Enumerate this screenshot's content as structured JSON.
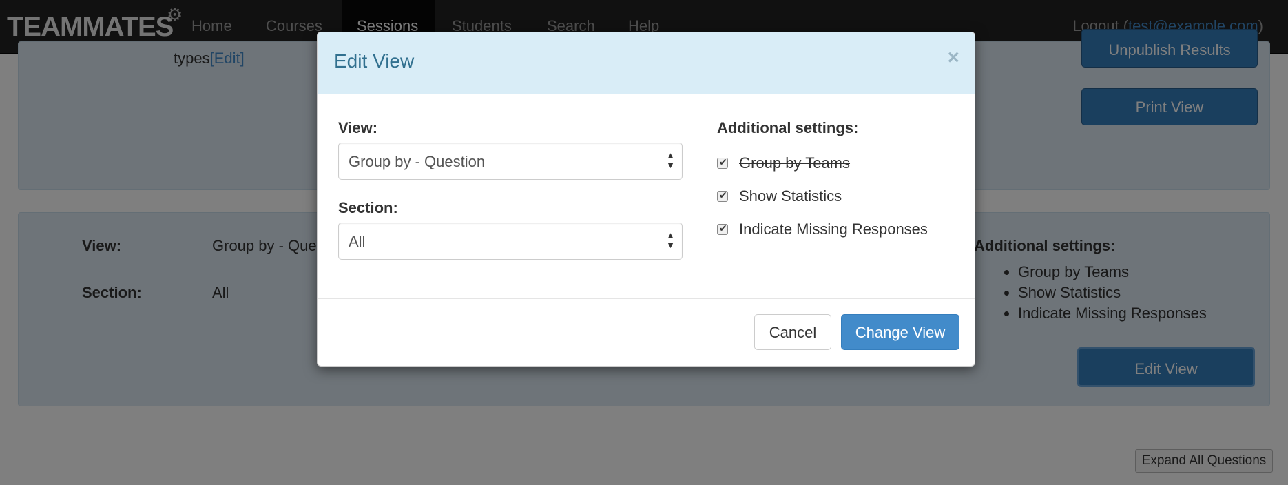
{
  "navbar": {
    "brand": "TEAMMATES",
    "items": [
      {
        "label": "Home"
      },
      {
        "label": "Courses"
      },
      {
        "label": "Sessions"
      },
      {
        "label": "Students"
      },
      {
        "label": "Search"
      },
      {
        "label": "Help"
      }
    ],
    "active_item": "Sessions",
    "logout_prefix": "Logout (",
    "logout_email": "test@example.com",
    "logout_suffix": ")"
  },
  "top_panel": {
    "types_text": "types",
    "edit_link": "[Edit]",
    "unpublish_label": "Unpublish Results",
    "print_label": "Print View"
  },
  "view_panel": {
    "view_label": "View:",
    "view_value": "Group by - Question",
    "section_label": "Section:",
    "section_value": "All",
    "settings_title": "Additional settings:",
    "settings": [
      "Group by Teams",
      "Show Statistics",
      "Indicate Missing Responses"
    ],
    "edit_view_label": "Edit View"
  },
  "expand_label": "Expand All Questions",
  "modal": {
    "title": "Edit View",
    "close": "×",
    "view_label": "View:",
    "view_value": "Group by - Question",
    "section_label": "Section:",
    "section_value": "All",
    "settings_title": "Additional settings:",
    "checkboxes": [
      {
        "label": "Group by Teams",
        "checked": true,
        "disabled": true
      },
      {
        "label": "Show Statistics",
        "checked": true
      },
      {
        "label": "Indicate Missing Responses",
        "checked": true
      }
    ],
    "cancel_label": "Cancel",
    "change_label": "Change View"
  },
  "colors": {
    "navbar_bg": "#222222",
    "panel_bg": "#dde9f3",
    "primary": "#428bca",
    "modal_header_bg": "#d9edf7",
    "modal_title": "#31708f"
  }
}
